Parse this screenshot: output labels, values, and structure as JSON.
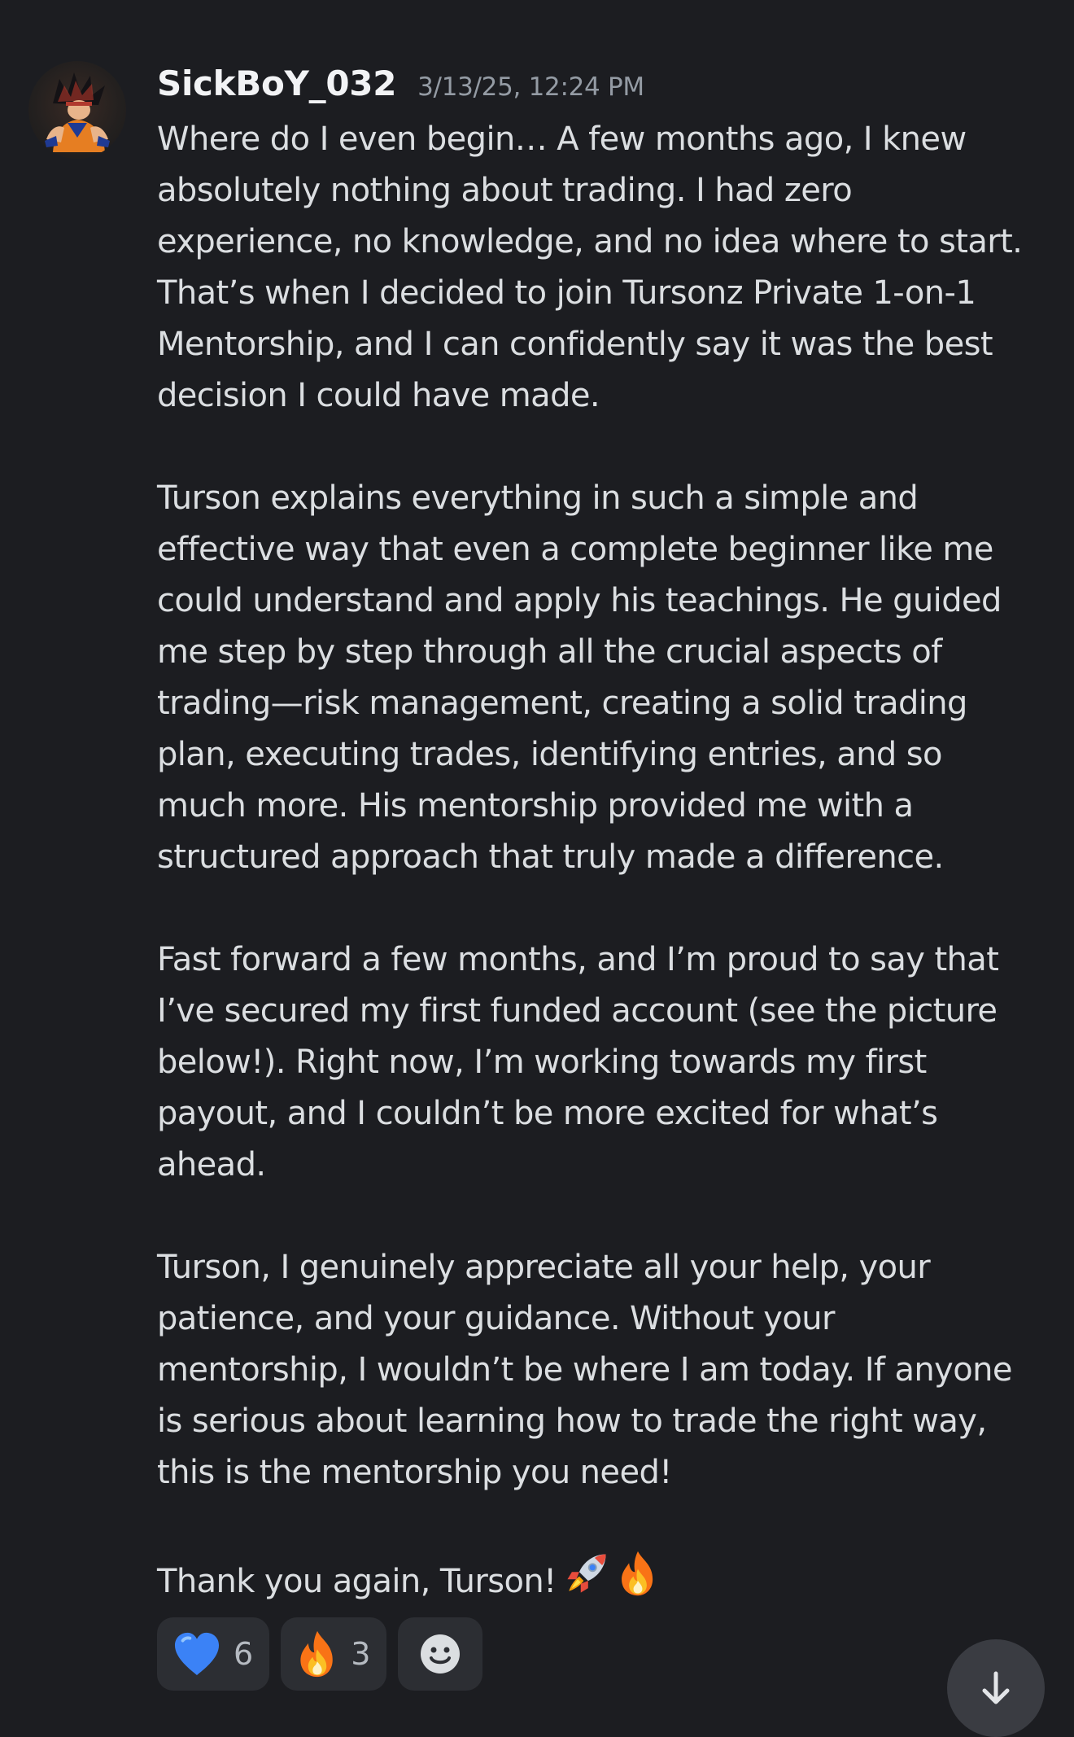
{
  "message": {
    "author": "SickBoY_032",
    "timestamp": "3/13/25, 12:24 PM",
    "paragraphs": [
      {
        "lines": [
          "Where do I even begin… A few months ago, I knew",
          "absolutely nothing about trading. I had zero",
          "experience, no knowledge, and no idea where to start.",
          "That’s when I decided to join Tursonz Private 1-on-1",
          "Mentorship, and I can confidently say it was the best",
          "decision I could have made."
        ]
      },
      {
        "lines": [
          "Turson explains everything in such a simple and",
          "effective way that even a complete beginner like me",
          "could understand and apply his teachings. He guided",
          "me step by step through all the crucial aspects of",
          "trading—risk management, creating a solid trading",
          "plan, executing trades, identifying entries, and so",
          "much more. His mentorship provided me with a",
          "structured approach that truly made a difference."
        ]
      },
      {
        "lines": [
          "Fast forward a few months, and I’m proud to say that",
          "I’ve secured my first funded account (see the picture",
          "below!). Right now, I’m working towards my first",
          "payout, and I couldn’t be more excited for what’s",
          "ahead."
        ]
      },
      {
        "lines": [
          "Turson, I genuinely appreciate all your help, your",
          "patience, and your guidance. Without your",
          "mentorship, I wouldn’t be where I am today. If anyone",
          "is serious about learning how to trade the right way,",
          "this is the mentorship you need!"
        ]
      }
    ],
    "closing": "Thank you again, Turson!",
    "closing_emojis": [
      "rocket-icon",
      "fire-icon"
    ]
  },
  "reactions": [
    {
      "icon": "blue-heart-icon",
      "count": "6"
    },
    {
      "icon": "fire-icon",
      "count": "3"
    }
  ],
  "add_reaction_icon": "smiley-icon",
  "scroll_button_icon": "arrow-down-icon",
  "colors": {
    "background": "#1c1d21",
    "text": "#dbdee1",
    "username": "#f2f3f5",
    "timestamp": "#949ba4",
    "reaction_bg": "#2c2e33",
    "blue_heart": "#3b82f6",
    "fire": "#f97316"
  }
}
